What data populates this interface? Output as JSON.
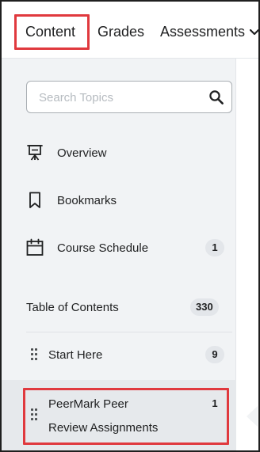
{
  "topnav": {
    "tabs": [
      {
        "label": "Content"
      },
      {
        "label": "Grades"
      },
      {
        "label": "Assessments"
      }
    ]
  },
  "sidebar": {
    "search": {
      "placeholder": "Search Topics"
    },
    "links": [
      {
        "label": "Overview",
        "icon": "presentation-icon"
      },
      {
        "label": "Bookmarks",
        "icon": "bookmark-icon"
      },
      {
        "label": "Course Schedule",
        "icon": "calendar-icon",
        "count": "1"
      }
    ],
    "toc": {
      "label": "Table of Contents",
      "count": "330"
    },
    "modules": [
      {
        "label": "Start Here",
        "count": "9"
      },
      {
        "label_line1": "PeerMark Peer",
        "label_line2": "Review Assignments",
        "count": "1"
      }
    ]
  },
  "colors": {
    "highlight": "#e0393e",
    "panel_bg": "#f1f3f5",
    "active_bg": "#e6e9ec",
    "badge_bg": "#e3e6ea"
  }
}
